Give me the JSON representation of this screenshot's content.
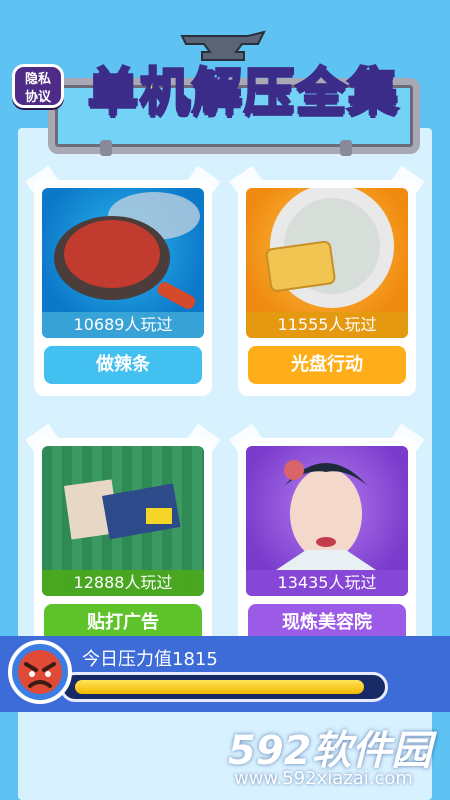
{
  "header": {
    "privacy_label_line1": "隐私",
    "privacy_label_line2": "协议",
    "title": "单机解压全集"
  },
  "cards": [
    {
      "name": "做辣条",
      "plays": "10689人玩过",
      "button_color": "#42c0ef",
      "plays_color": "#3aa4d6"
    },
    {
      "name": "光盘行动",
      "plays": "11555人玩过",
      "button_color": "#ffae1a",
      "plays_color": "#e39a11"
    },
    {
      "name": "贴打广告",
      "plays": "12888人玩过",
      "button_color": "#5ec22a",
      "plays_color": "#4aa81f"
    },
    {
      "name": "现炼美容院",
      "plays": "13435人玩过",
      "button_color": "#9c5be6",
      "plays_color": "#8848d6"
    }
  ],
  "stress": {
    "label": "今日压力值1815",
    "fill_fraction": 0.97
  },
  "watermark": {
    "brand": "592软件园",
    "url": "www.592xiazai.com"
  }
}
